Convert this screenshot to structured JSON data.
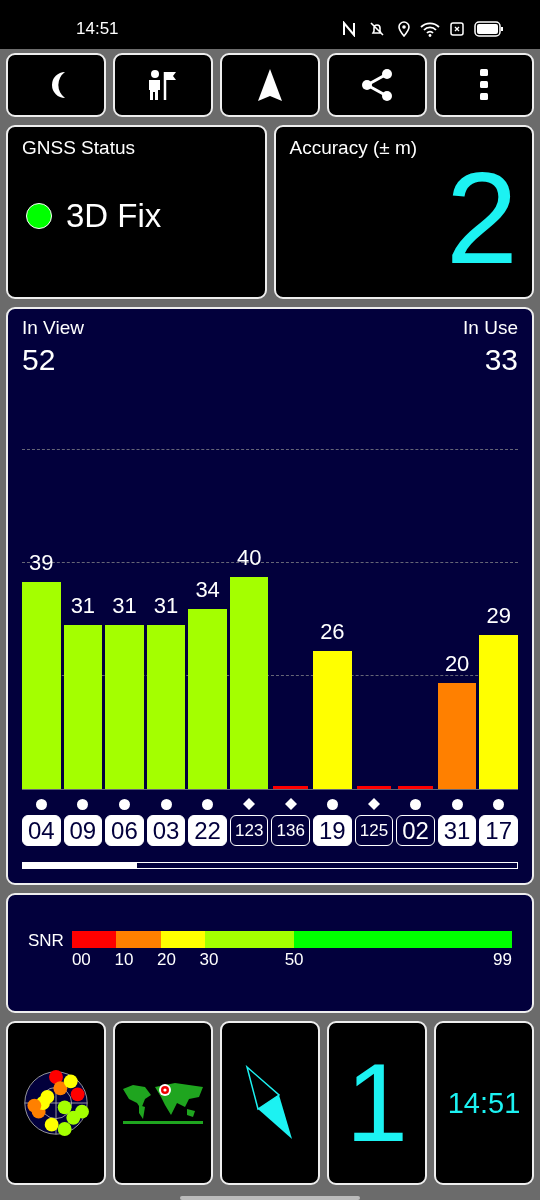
{
  "status_bar": {
    "time": "14:51"
  },
  "gnss_status": {
    "title": "GNSS Status",
    "fix": "3D Fix",
    "color": "#00ff00"
  },
  "accuracy": {
    "title": "Accuracy (± m)",
    "value": "2"
  },
  "satellites_panel": {
    "in_view_label": "In View",
    "in_view": "52",
    "in_use_label": "In Use",
    "in_use": "33",
    "satellites": [
      {
        "id": "04",
        "snr": "39",
        "color": "#a4ff00",
        "used": true,
        "kind": "dot"
      },
      {
        "id": "09",
        "snr": "31",
        "color": "#a4ff00",
        "used": true,
        "kind": "dot"
      },
      {
        "id": "06",
        "snr": "31",
        "color": "#a4ff00",
        "used": true,
        "kind": "dot"
      },
      {
        "id": "03",
        "snr": "31",
        "color": "#a4ff00",
        "used": true,
        "kind": "dot"
      },
      {
        "id": "22",
        "snr": "34",
        "color": "#a4ff00",
        "used": true,
        "kind": "dot"
      },
      {
        "id": "123",
        "snr": "40",
        "color": "#a4ff00",
        "used": false,
        "kind": "diamond"
      },
      {
        "id": "136",
        "color": "#ff0000",
        "used": false,
        "kind": "diamond"
      },
      {
        "id": "19",
        "snr": "26",
        "color": "#ffff00",
        "used": true,
        "kind": "dot"
      },
      {
        "id": "125",
        "color": "#ff0000",
        "used": false,
        "kind": "diamond"
      },
      {
        "id": "02",
        "color": "#ff0000",
        "used": false,
        "kind": "dot"
      },
      {
        "id": "31",
        "snr": "20",
        "color": "#ff8000",
        "used": true,
        "kind": "dot"
      },
      {
        "id": "17",
        "snr": "29",
        "color": "#ffff00",
        "used": true,
        "kind": "dot"
      }
    ]
  },
  "snr_legend": {
    "label": "SNR",
    "segments": [
      {
        "tick": "00",
        "color": "#ff0000"
      },
      {
        "tick": "10",
        "color": "#ff8000"
      },
      {
        "tick": "20",
        "color": "#ffff00"
      },
      {
        "tick": "30",
        "color": "#a4ff00"
      },
      {
        "tick": "50",
        "color": "#00ff00"
      }
    ],
    "end_tick": "99"
  },
  "bottom_tiles": {
    "satellites_in_fix": "1",
    "clock": "14:51"
  }
}
